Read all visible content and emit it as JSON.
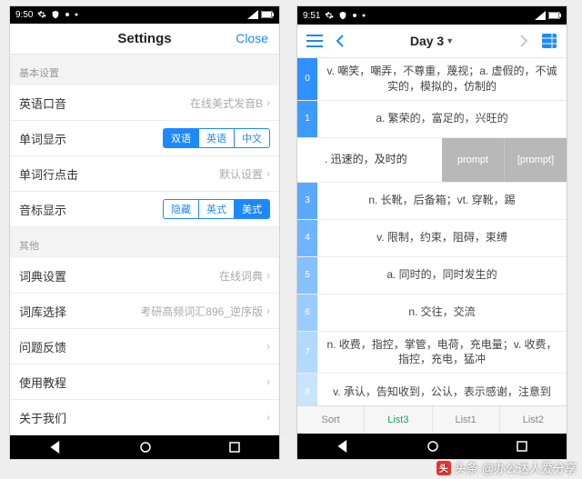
{
  "left": {
    "status_time": "9:50",
    "header_title": "Settings",
    "header_close": "Close",
    "section1": "基本设置",
    "rows1": [
      {
        "label": "英语口音",
        "value": "在线美式发音B",
        "type": "value"
      },
      {
        "label": "单词显示",
        "type": "seg",
        "options": [
          "双语",
          "英语",
          "中文"
        ],
        "active": 0
      },
      {
        "label": "单词行点击",
        "value": "默认设置",
        "type": "value"
      },
      {
        "label": "音标显示",
        "type": "seg",
        "options": [
          "隐藏",
          "英式",
          "美式"
        ],
        "active": 2
      }
    ],
    "section2": "其他",
    "rows2": [
      {
        "label": "词典设置",
        "value": "在线词典",
        "type": "value"
      },
      {
        "label": "词库选择",
        "value": "考研高频词汇896_逆序版",
        "type": "value"
      },
      {
        "label": "问题反馈",
        "value": "",
        "type": "value"
      },
      {
        "label": "使用教程",
        "value": "",
        "type": "value"
      },
      {
        "label": "关于我们",
        "value": "",
        "type": "value"
      }
    ]
  },
  "right": {
    "status_time": "9:51",
    "day_title": "Day 3",
    "cards": [
      {
        "n": "0",
        "shade": "#2f90ff",
        "def": "v. 嘲笑，嘲弄，不尊重，蔑视；a. 虚假的，不诚实的，模拟的，仿制的"
      },
      {
        "n": "1",
        "shade": "#3f9aff",
        "def": "a. 繁荣的，富足的，兴旺的"
      },
      {
        "n": "",
        "shade": "#ffffff",
        "def": ". 迅速的，及时的",
        "selected": true,
        "b1": "prompt",
        "b2": "[prɒmpt]"
      },
      {
        "n": "3",
        "shade": "#5aa8ff",
        "def": "n. 长靴，后备箱；vt. 穿靴，踢"
      },
      {
        "n": "4",
        "shade": "#6fb4ff",
        "def": "v. 限制，约束，阻碍，束缚"
      },
      {
        "n": "5",
        "shade": "#85c0ff",
        "def": "a. 同时的，同时发生的"
      },
      {
        "n": "6",
        "shade": "#9bccff",
        "def": "n. 交往，交流"
      },
      {
        "n": "7",
        "shade": "#b2d9ff",
        "def": "n. 收费，指控，掌管，电荷，充电量；v. 收费，指控，充电，猛冲"
      },
      {
        "n": "8",
        "shade": "#c8e4ff",
        "def": "v. 承认，告知收到，公认，表示感谢，注意到"
      }
    ],
    "tabs": [
      "Sort",
      "List3",
      "List1",
      "List2"
    ],
    "tab_active": 1
  },
  "watermark": {
    "prefix": "头条",
    "text": "@办公达人爱分享"
  }
}
